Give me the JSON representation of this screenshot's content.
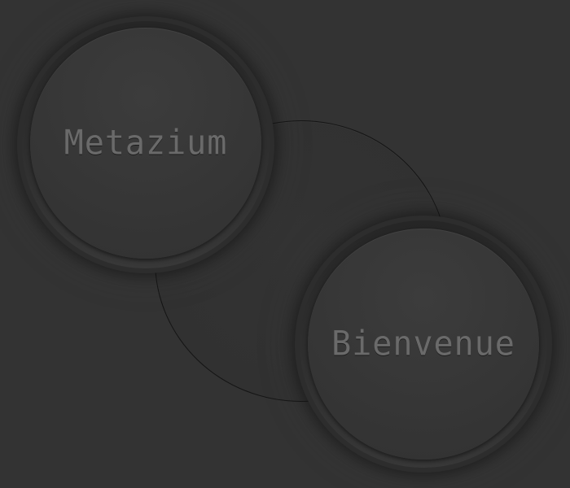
{
  "buttons": {
    "top": {
      "label": "Metazium"
    },
    "bottom": {
      "label": "Bienvenue"
    }
  },
  "colors": {
    "background": "#333333",
    "orb_face": "#363636",
    "label": "#6a6a6a",
    "connector_stroke": "#141414"
  }
}
